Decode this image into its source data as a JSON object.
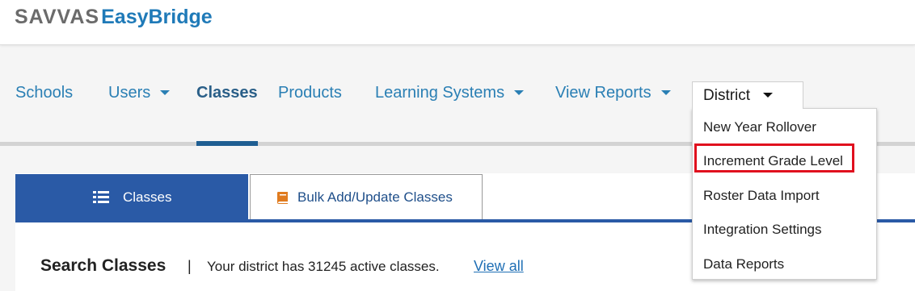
{
  "brand": {
    "part1": "SAVVAS",
    "part2": "EasyBridge"
  },
  "nav": {
    "items": [
      {
        "label": "Schools"
      },
      {
        "label": "Users"
      },
      {
        "label": "Classes"
      },
      {
        "label": "Products"
      },
      {
        "label": "Learning Systems"
      },
      {
        "label": "View Reports"
      },
      {
        "label": "District"
      }
    ],
    "active": "Classes"
  },
  "district_menu": {
    "items": [
      {
        "label": "New Year Rollover"
      },
      {
        "label": "Increment Grade Level",
        "highlighted": true
      },
      {
        "label": "Roster Data Import"
      },
      {
        "label": "Integration Settings"
      },
      {
        "label": "Data Reports"
      }
    ]
  },
  "tabs": {
    "classes": {
      "label": "Classes",
      "icon": "list-icon"
    },
    "bulk": {
      "label": "Bulk Add/Update Classes",
      "icon": "book-icon"
    }
  },
  "search": {
    "title": "Search Classes",
    "separator": "|",
    "count_text": "Your district has 31245 active classes.",
    "view_all": "View all"
  },
  "colors": {
    "nav_link": "#2a7fb4",
    "active_tab": "#2a5aa6",
    "highlight": "#e0101e"
  }
}
